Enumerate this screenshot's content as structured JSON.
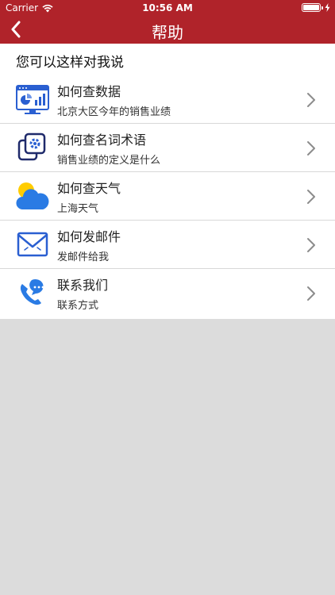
{
  "status_bar": {
    "carrier": "Carrier",
    "time": "10:56 AM"
  },
  "nav": {
    "title": "帮助",
    "back_icon": "chevron-left-icon"
  },
  "section_title": "您可以这样对我说",
  "items": [
    {
      "title": "如何查数据",
      "subtitle": "北京大区今年的销售业绩",
      "icon": "data-dashboard-icon"
    },
    {
      "title": "如何查名词术语",
      "subtitle": "销售业绩的定义是什么",
      "icon": "glossary-gear-icon"
    },
    {
      "title": "如何查天气",
      "subtitle": "上海天气",
      "icon": "weather-cloud-sun-icon"
    },
    {
      "title": "如何发邮件",
      "subtitle": "发邮件给我",
      "icon": "mail-envelope-icon"
    },
    {
      "title": "联系我们",
      "subtitle": "联系方式",
      "icon": "phone-chat-icon"
    }
  ],
  "colors": {
    "nav_bg": "#b0232a",
    "icon_blue": "#2a5fd1",
    "background": "#dcdcdc"
  }
}
